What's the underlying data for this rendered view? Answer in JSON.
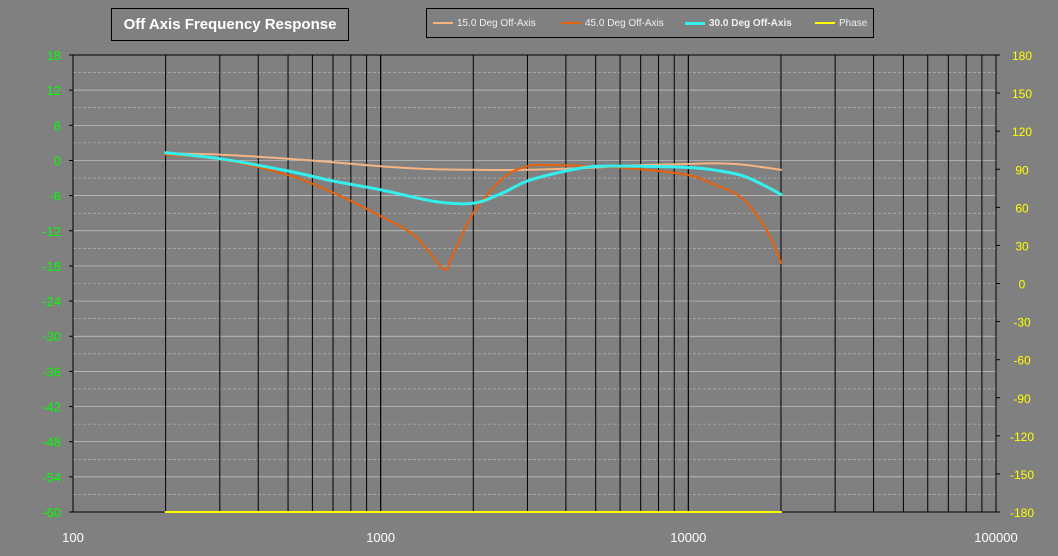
{
  "chart_data": {
    "type": "line",
    "title": "Off Axis Frequency Response",
    "x_scale": "log",
    "xlim": [
      100,
      100000
    ],
    "x_ticks": [
      100,
      1000,
      10000,
      100000
    ],
    "x_tick_labels": [
      "100",
      "1000",
      "10000",
      "100000"
    ],
    "ylim_left": [
      -60,
      18
    ],
    "y_ticks_left": [
      18,
      12,
      6,
      0,
      -6,
      -12,
      -18,
      -24,
      -30,
      -36,
      -42,
      -48,
      -54,
      -60
    ],
    "ylim_right": [
      -180,
      180
    ],
    "y_ticks_right": [
      180,
      150,
      120,
      90,
      60,
      30,
      0,
      -30,
      -60,
      -90,
      -120,
      -150,
      -180
    ],
    "grid": true,
    "legend_position": "top",
    "colors": {
      "background": "#808080",
      "left_axis_text": "#00ff00",
      "right_axis_text": "#ffff00",
      "x_axis_text": "#ffffff"
    },
    "series": [
      {
        "name": "15.0 Deg Off-Axis",
        "color": "#f5b483",
        "axis": "left",
        "x": [
          200,
          300,
          500,
          700,
          1000,
          1500,
          2000,
          3000,
          5000,
          7000,
          10000,
          12000,
          15000,
          20000
        ],
        "values": [
          1.2,
          1.0,
          0.3,
          -0.3,
          -1.0,
          -1.5,
          -1.6,
          -1.6,
          -1.2,
          -0.8,
          -0.6,
          -0.5,
          -0.7,
          -1.6
        ]
      },
      {
        "name": "45.0 Deg Off-Axis",
        "color": "#e8600a",
        "axis": "left",
        "x": [
          200,
          300,
          500,
          700,
          1000,
          1300,
          1600,
          1700,
          2000,
          2500,
          3000,
          3500,
          5000,
          7000,
          10000,
          12000,
          15000,
          18000,
          20000
        ],
        "values": [
          1.0,
          0.2,
          -2.5,
          -5.5,
          -9.5,
          -13.0,
          -18.5,
          -16.5,
          -9.0,
          -3.0,
          -1.0,
          -0.8,
          -1.0,
          -1.5,
          -2.5,
          -4.0,
          -6.5,
          -12.0,
          -17.5
        ]
      },
      {
        "name": "30.0 Deg Off-Axis",
        "color": "#33f0ee",
        "axis": "left",
        "bold": true,
        "x": [
          200,
          300,
          500,
          700,
          1000,
          1500,
          2000,
          2500,
          3000,
          4000,
          5000,
          7000,
          10000,
          12000,
          15000,
          18000,
          20000
        ],
        "values": [
          1.3,
          0.3,
          -1.8,
          -3.5,
          -5.0,
          -7.0,
          -7.3,
          -5.5,
          -3.5,
          -1.8,
          -1.0,
          -1.0,
          -1.2,
          -1.6,
          -2.6,
          -4.5,
          -5.8
        ]
      },
      {
        "name": "Phase",
        "color": "#ffff00",
        "axis": "right",
        "x": [
          200,
          20000
        ],
        "values": [
          -180,
          -180
        ]
      }
    ]
  }
}
